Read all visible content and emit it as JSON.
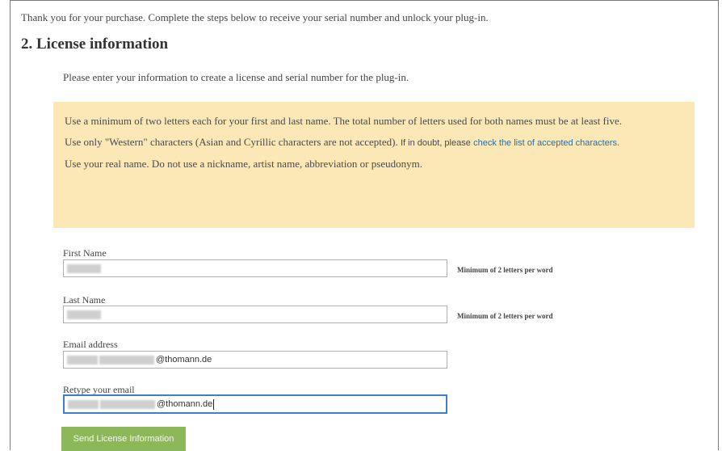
{
  "intro_text": "Thank you for your purchase. Complete the steps below to receive your serial number and unlock your plug-in.",
  "section_title": "2. License information",
  "subtext": "Please enter your information to create a license and serial number for the plug-in.",
  "notice": {
    "rule1": "Use a minimum of two letters each for your first and last name. The total number of letters used for both names must be at least five.",
    "rule2_start": "Use only \"Western\" characters (Asian and Cyrillic characters are not accepted).",
    "rule2_doubt": "If in doubt, please",
    "rule2_link": "check the list of accepted characters.",
    "rule3": "Use your real name. Do not use a nickname, artist name, abbreviation or pseudonym."
  },
  "form": {
    "first_name_label": "First Name",
    "first_name_hint": "Minimum of 2 letters per word",
    "last_name_label": "Last Name",
    "last_name_hint": "Minimum of 2 letters per word",
    "email_label": "Email address",
    "email_domain": "@thomann.de",
    "retype_label": "Retype your email",
    "retype_domain": "@thomann.de",
    "submit_label": "Send License Information"
  },
  "colors": {
    "notice_bg": "#fbe8b6",
    "link": "#2d6e9c",
    "button_bg": "#8cb85a",
    "focus_border": "#3b7fd0"
  }
}
